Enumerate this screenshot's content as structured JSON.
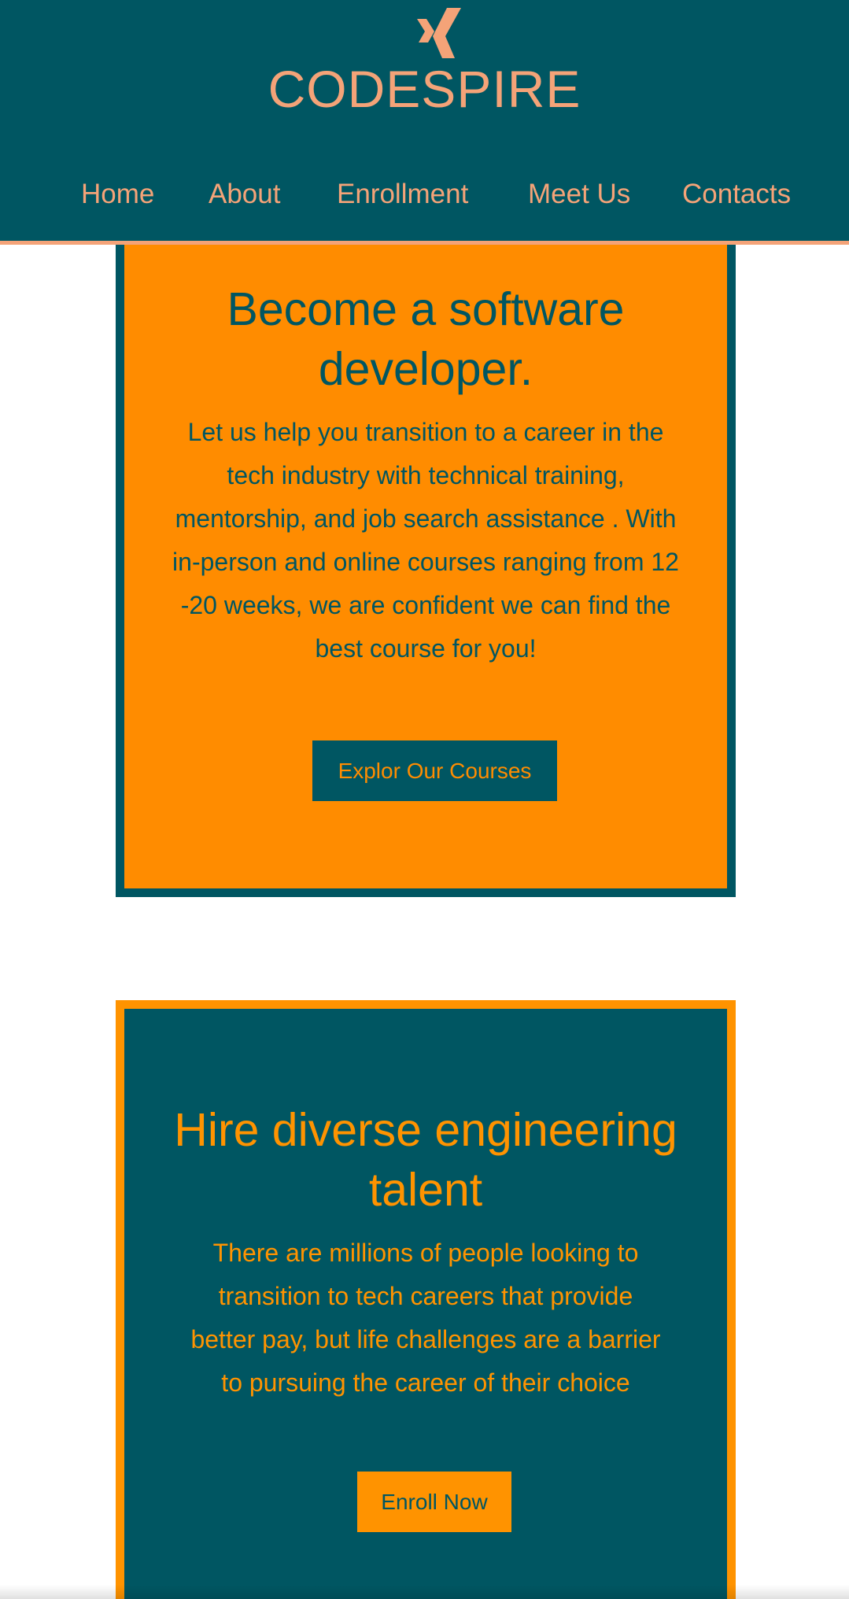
{
  "colors": {
    "teal": "#005662",
    "header_accent": "#f4a378",
    "hero_orange": "#ff8c00",
    "talent_orange": "#ff9300",
    "background": "#ffffff"
  },
  "header": {
    "logo_icon": "xing-style-logo-icon",
    "brand_name": "CODESPIRE",
    "nav": [
      {
        "label": "Home"
      },
      {
        "label": "About"
      },
      {
        "label": "Enrollment"
      },
      {
        "label": "Meet Us"
      },
      {
        "label": "Contacts"
      }
    ]
  },
  "hero": {
    "title": "Become a software developer.",
    "text": "Let us help you transition to a career in the tech industry with technical training, mentorship, and job search assistance . With in-person and online courses ranging from 12 -20 weeks, we are confident we can find the best course for you!",
    "button_label": "Explor Our Courses"
  },
  "talent": {
    "title": "Hire diverse engineering talent",
    "text": "There are millions of people looking to transition to tech careers that provide better pay, but life challenges are a barrier to pursuing the career of their choice",
    "button_label": "Enroll Now"
  }
}
